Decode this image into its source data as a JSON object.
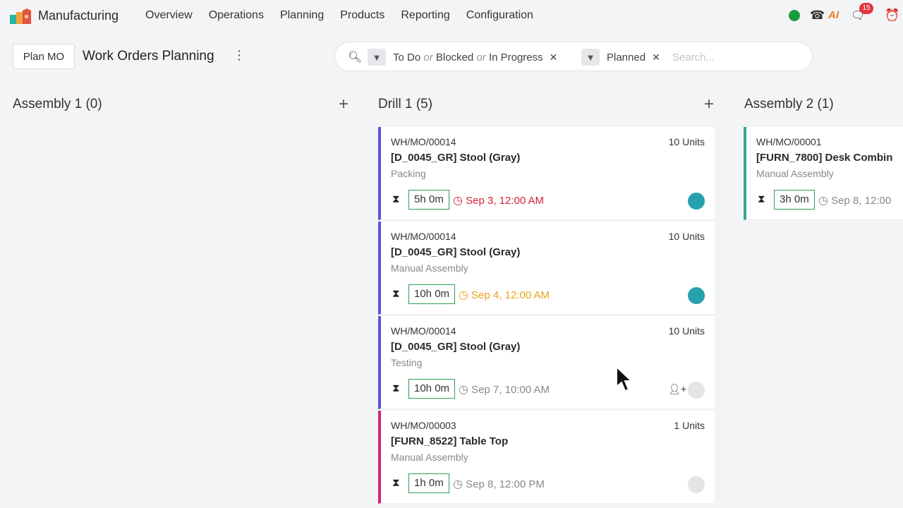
{
  "navbar": {
    "app_name": "Manufacturing",
    "menu": [
      "Overview",
      "Operations",
      "Planning",
      "Products",
      "Reporting",
      "Configuration"
    ],
    "chat_badge": "15"
  },
  "control": {
    "plan_button": "Plan MO",
    "title": "Work Orders Planning"
  },
  "search": {
    "facets": [
      {
        "parts": [
          "To Do",
          "or",
          "Blocked",
          "or",
          "In Progress"
        ]
      },
      {
        "parts": [
          "Planned"
        ]
      }
    ],
    "placeholder": "Search..."
  },
  "columns": [
    {
      "title": "Assembly 1 (0)",
      "cards": []
    },
    {
      "title": "Drill 1 (5)",
      "cards": [
        {
          "ref": "WH/MO/00014",
          "qty": "10 Units",
          "product": "[D_0045_GR] Stool (Gray)",
          "operation": "Packing",
          "duration": "5h 0m",
          "date": "Sep 3, 12:00 AM",
          "date_color": "#d1213c",
          "border_color": "#5b54d6",
          "avatar_color": "#27a1ad"
        },
        {
          "ref": "WH/MO/00014",
          "qty": "10 Units",
          "product": "[D_0045_GR] Stool (Gray)",
          "operation": "Manual Assembly",
          "duration": "10h 0m",
          "date": "Sep 4, 12:00 AM",
          "date_color": "#e9a21c",
          "border_color": "#5b54d6",
          "avatar_color": "#27a1ad"
        },
        {
          "ref": "WH/MO/00014",
          "qty": "10 Units",
          "product": "[D_0045_GR] Stool (Gray)",
          "operation": "Testing",
          "duration": "10h 0m",
          "date": "Sep 7, 10:00 AM",
          "date_color": "#888888",
          "border_color": "#5b54d6",
          "avatar_color": "#e4e4e4",
          "unassigned": true
        },
        {
          "ref": "WH/MO/00003",
          "qty": "1 Units",
          "product": "[FURN_8522] Table Top",
          "operation": "Manual Assembly",
          "duration": "1h 0m",
          "date": "Sep 8, 12:00 PM",
          "date_color": "#888888",
          "border_color": "#d1267a",
          "avatar_color": "#e4e4e4"
        }
      ]
    },
    {
      "title": "Assembly 2 (1)",
      "cards": [
        {
          "ref": "WH/MO/00001",
          "qty": "",
          "product": "[FURN_7800] Desk Combin",
          "operation": "Manual Assembly",
          "duration": "3h 0m",
          "date": "Sep 8, 12:00",
          "date_color": "#888888",
          "border_color": "#35a88e",
          "avatar_color": ""
        }
      ]
    }
  ]
}
